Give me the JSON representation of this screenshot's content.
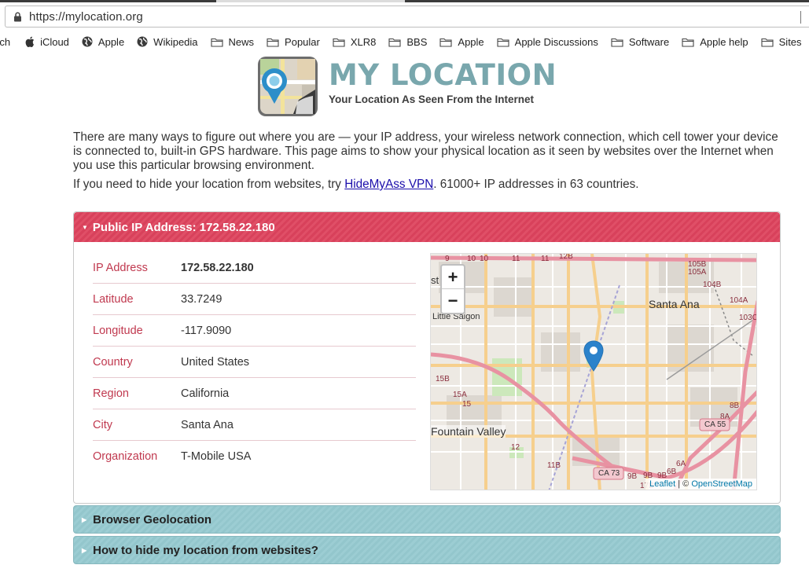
{
  "browser": {
    "url": "https://mylocation.org",
    "bookmarks": [
      {
        "label": "rch",
        "icon": "none"
      },
      {
        "label": "iCloud",
        "icon": "apple-icon"
      },
      {
        "label": "Apple",
        "icon": "globe-icon"
      },
      {
        "label": "Wikipedia",
        "icon": "globe-icon"
      },
      {
        "label": "News",
        "icon": "folder-icon"
      },
      {
        "label": "Popular",
        "icon": "folder-icon"
      },
      {
        "label": "XLR8",
        "icon": "folder-icon"
      },
      {
        "label": "BBS",
        "icon": "folder-icon"
      },
      {
        "label": "Apple",
        "icon": "folder-icon"
      },
      {
        "label": "Apple Discussions",
        "icon": "folder-icon"
      },
      {
        "label": "Software",
        "icon": "folder-icon"
      },
      {
        "label": "Apple help",
        "icon": "folder-icon"
      },
      {
        "label": "Sites",
        "icon": "folder-icon"
      }
    ]
  },
  "header": {
    "title": "MY LOCATION",
    "subtitle": "Your Location As Seen From the Internet"
  },
  "intro": {
    "paragraph1": "There are many ways to figure out where you are — your IP address, your wireless network connection, which cell tower your device is connected to, built-in GPS hardware. This page aims to show your physical location as it seen by websites over the Internet when you use this particular browsing environment.",
    "paragraph2_before": "If you need to hide your location from websites, try ",
    "link_text": "HideMyAss VPN",
    "paragraph2_after": ". 61000+ IP addresses in 63 countries."
  },
  "ip_panel": {
    "title": "Public IP Address: 172.58.22.180",
    "rows": [
      {
        "label": "IP Address",
        "value": "172.58.22.180"
      },
      {
        "label": "Latitude",
        "value": "33.7249"
      },
      {
        "label": "Longitude",
        "value": "-117.9090"
      },
      {
        "label": "Country",
        "value": "United States"
      },
      {
        "label": "Region",
        "value": "California"
      },
      {
        "label": "City",
        "value": "Santa Ana"
      },
      {
        "label": "Organization",
        "value": "T-Mobile USA"
      }
    ]
  },
  "map": {
    "zoom_in": "+",
    "zoom_out": "−",
    "labels": {
      "santa_ana": "Santa Ana",
      "little_saigon": "Little Saigon",
      "fountain_valley": "Fountain Valley",
      "st": "st",
      "ca55": "CA 55",
      "ca73": "CA 73"
    },
    "attribution_leaflet": "Leaflet",
    "attribution_sep": " | © ",
    "attribution_osm": "OpenStreetMap",
    "colors": {
      "pin": "#2b82cb",
      "highway": "#e892a2",
      "major_road": "#f5c77e"
    }
  },
  "panels": {
    "browser_geo": "Browser Geolocation",
    "hide_location": "How to hide my location from websites?"
  },
  "colors": {
    "accent_red": "#d8415b",
    "accent_blue": "#93c6cc",
    "logo_teal": "#79a7ad"
  }
}
